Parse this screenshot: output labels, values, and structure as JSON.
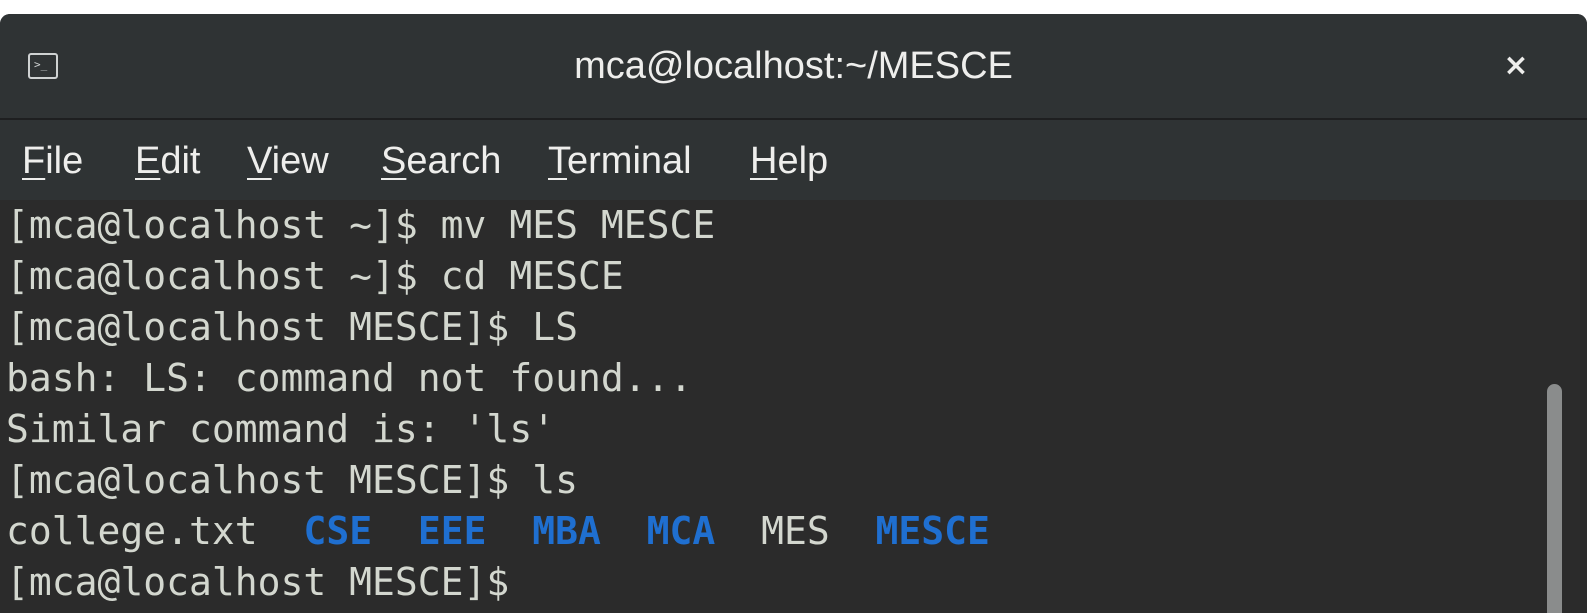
{
  "window": {
    "title": "mca@localhost:~/MESCE",
    "icon": "terminal-icon",
    "icon_glyph": ">_",
    "close_label": "×",
    "close_icon": "close-icon"
  },
  "menu": {
    "items": [
      {
        "mnemonic": "F",
        "rest": "ile"
      },
      {
        "mnemonic": "E",
        "rest": "dit"
      },
      {
        "mnemonic": "V",
        "rest": "iew"
      },
      {
        "mnemonic": "S",
        "rest": "earch"
      },
      {
        "mnemonic": "T",
        "rest": "erminal"
      },
      {
        "mnemonic": "H",
        "rest": "elp"
      }
    ]
  },
  "terminal": {
    "lines": [
      "[mca@localhost ~]$ mv MES MESCE",
      "[mca@localhost ~]$ cd MESCE",
      "[mca@localhost MESCE]$ LS",
      "bash: LS: command not found...",
      "Similar command is: 'ls'",
      "[mca@localhost MESCE]$ ls"
    ],
    "ls_output": [
      {
        "name": "college.txt",
        "type": "file"
      },
      {
        "name": "CSE",
        "type": "dir"
      },
      {
        "name": "EEE",
        "type": "dir"
      },
      {
        "name": "MBA",
        "type": "dir"
      },
      {
        "name": "MCA",
        "type": "dir"
      },
      {
        "name": "MES",
        "type": "file"
      },
      {
        "name": "MESCE",
        "type": "dir"
      }
    ],
    "last_prompt": "[mca@localhost MESCE]$ "
  },
  "colors": {
    "background": "#2b2b2b",
    "text": "#d3d7cf",
    "directory": "#1f6fd0",
    "titlebar": "#2f3334"
  }
}
